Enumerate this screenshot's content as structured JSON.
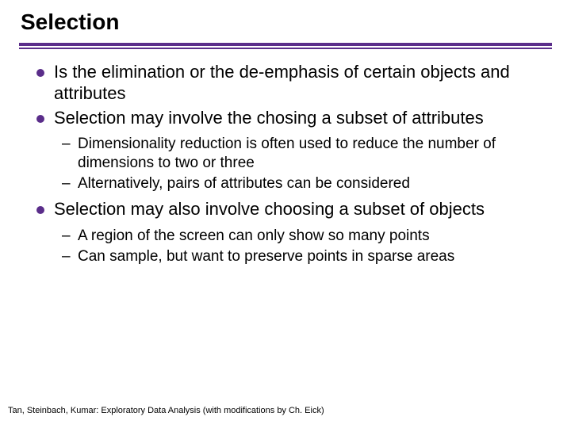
{
  "title": "Selection",
  "bullets": {
    "b1_0": "Is the elimination or the de-emphasis of certain objects and attributes",
    "b1_1": "Selection may involve the chosing a subset of attributes",
    "b2_0": "Dimensionality reduction is often used to reduce the number of dimensions to two or three",
    "b2_1": "Alternatively, pairs of attributes can be considered",
    "b1_2": "Selection may also involve choosing a subset of objects",
    "b2_2": " A region of the screen can only show so many points",
    "b2_3": "Can sample, but want to preserve points in sparse areas"
  },
  "footer": "Tan, Steinbach, Kumar: Exploratory Data Analysis (with modifications by Ch. Eick)"
}
